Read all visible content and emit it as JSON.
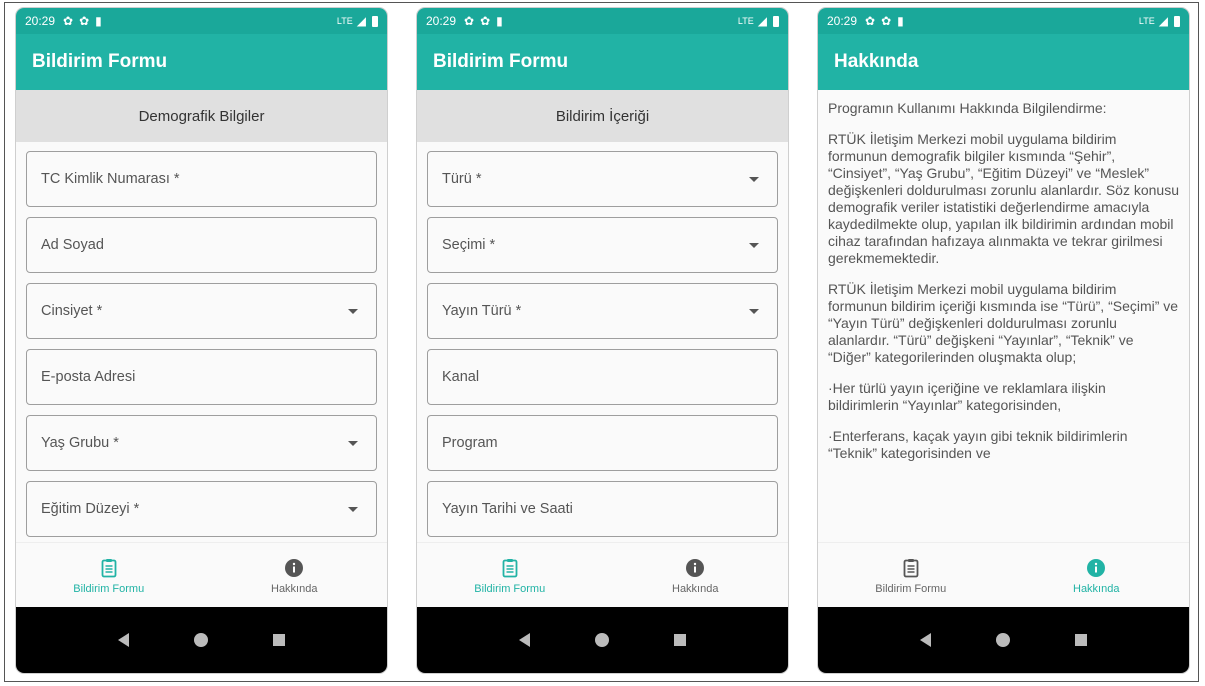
{
  "status": {
    "time": "20:29",
    "network": "LTE"
  },
  "screens": [
    {
      "title": "Bildirim Formu",
      "section": "Demografik Bilgiler",
      "fields": [
        {
          "label": "TC Kimlik Numarası *",
          "dropdown": false
        },
        {
          "label": "Ad Soyad",
          "dropdown": false
        },
        {
          "label": "Cinsiyet *",
          "dropdown": true
        },
        {
          "label": "E-posta Adresi",
          "dropdown": false
        },
        {
          "label": "Yaş Grubu *",
          "dropdown": true
        },
        {
          "label": "Eğitim Düzeyi *",
          "dropdown": true
        }
      ],
      "active_tab": "form"
    },
    {
      "title": "Bildirim Formu",
      "section": "Bildirim İçeriği",
      "fields": [
        {
          "label": "Türü *",
          "dropdown": true
        },
        {
          "label": "Seçimi *",
          "dropdown": true
        },
        {
          "label": "Yayın Türü *",
          "dropdown": true
        },
        {
          "label": "Kanal",
          "dropdown": false
        },
        {
          "label": "Program",
          "dropdown": false
        },
        {
          "label": "Yayın Tarihi ve Saati",
          "dropdown": false
        }
      ],
      "active_tab": "form"
    },
    {
      "title": "Hakkında",
      "paragraphs": [
        "Programın Kullanımı Hakkında Bilgilendirme:",
        "RTÜK İletişim Merkezi mobil uygulama bildirim formunun demografik bilgiler kısmında “Şehir”, “Cinsiyet”, “Yaş Grubu”, “Eğitim Düzeyi” ve “Meslek” değişkenleri doldurulması zorunlu alanlardır. Söz konusu demografik veriler istatistiki değerlendirme amacıyla kaydedilmekte olup, yapılan ilk bildirimin ardından mobil cihaz tarafından hafızaya alınmakta ve tekrar girilmesi gerekmemektedir.",
        "RTÜK İletişim Merkezi mobil uygulama bildirim formunun bildirim içeriği kısmında ise “Türü”, “Seçimi” ve “Yayın Türü” değişkenleri doldurulması zorunlu alanlardır. “Türü” değişkeni “Yayınlar”, “Teknik” ve “Diğer” kategorilerinden oluşmakta olup;",
        "·Her türlü yayın içeriğine ve reklamlara ilişkin bildirimlerin “Yayınlar” kategorisinden,",
        "·Enterferans, kaçak yayın gibi teknik bildirimlerin “Teknik” kategorisinden ve"
      ],
      "active_tab": "about"
    }
  ],
  "nav": {
    "form_label": "Bildirim Formu",
    "about_label": "Hakkında"
  },
  "colors": {
    "accent": "#21b3a5",
    "statusbar": "#1aa89a"
  }
}
